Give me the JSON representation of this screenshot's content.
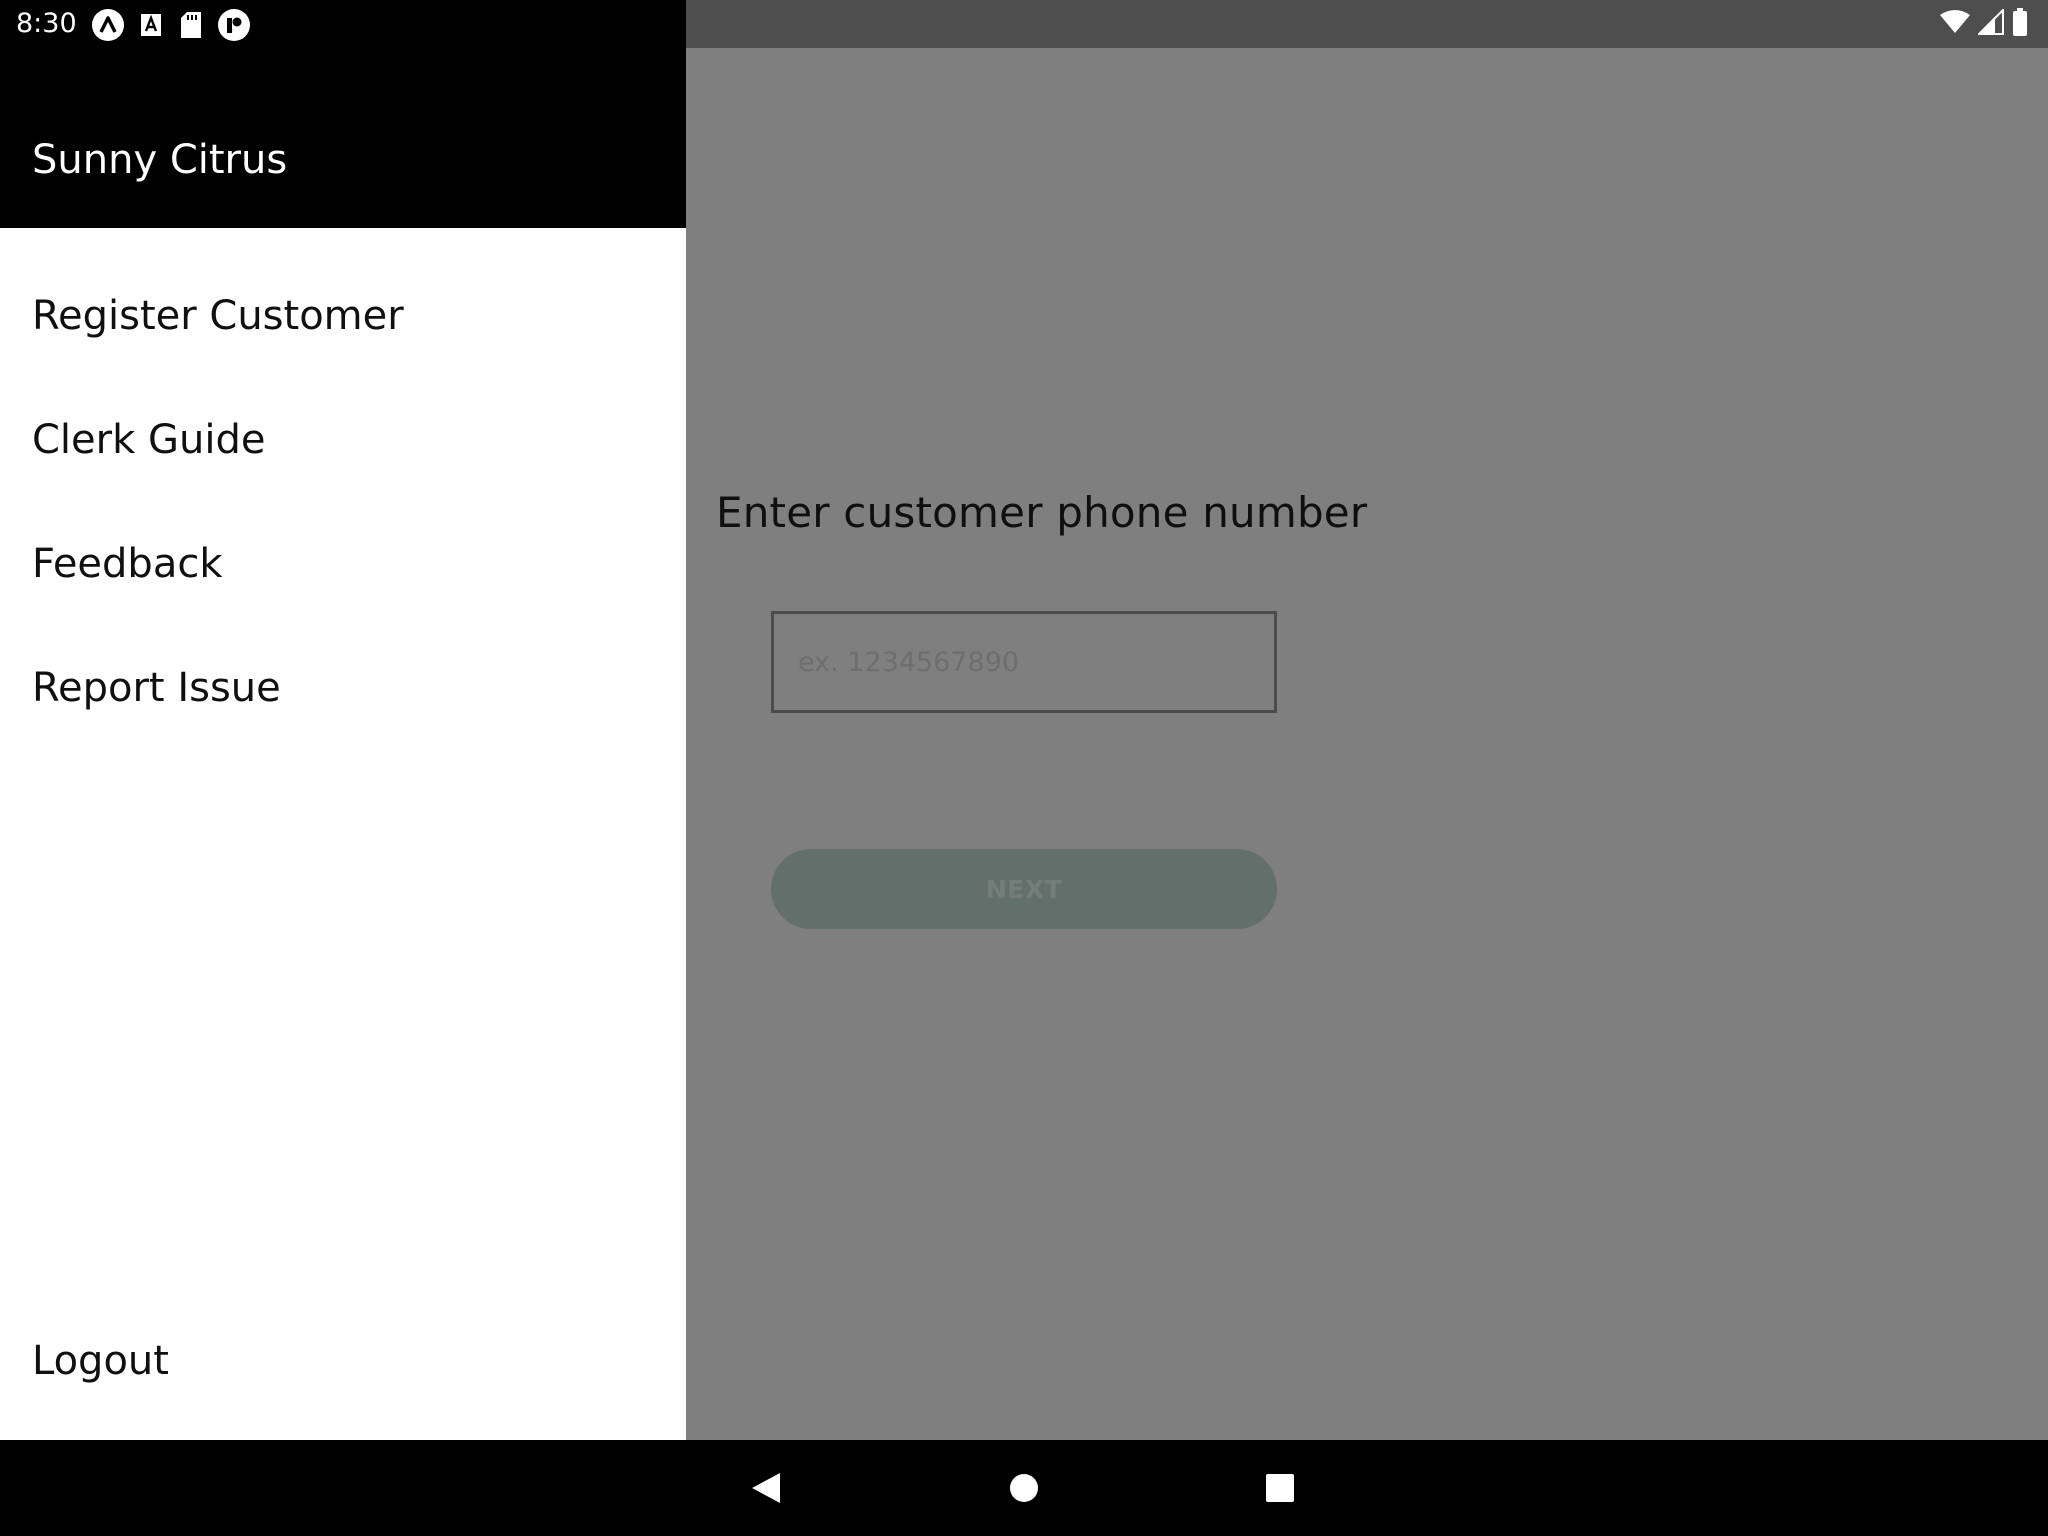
{
  "status_bar": {
    "time": "8:30",
    "left_icons": [
      "app-a-icon",
      "text-a-icon",
      "sd-card-icon",
      "circle-app-icon"
    ],
    "right_icons": [
      "wifi-icon",
      "signal-icon",
      "battery-icon"
    ]
  },
  "drawer": {
    "title": "Sunny Citrus",
    "items": [
      {
        "label": "Register Customer"
      },
      {
        "label": "Clerk Guide"
      },
      {
        "label": "Feedback"
      },
      {
        "label": "Report Issue"
      }
    ],
    "logout_label": "Logout"
  },
  "main": {
    "prompt": "Enter customer phone number",
    "phone_input": {
      "value": "",
      "placeholder": "ex. 1234567890"
    },
    "next_label": "NEXT"
  },
  "nav_bar": {
    "icons": [
      "back-icon",
      "home-icon",
      "recents-icon"
    ]
  },
  "colors": {
    "scrim": "#7f7f7f",
    "drawer_header": "#000000",
    "drawer_bg": "#ffffff",
    "button_disabled": "#636f6a"
  }
}
